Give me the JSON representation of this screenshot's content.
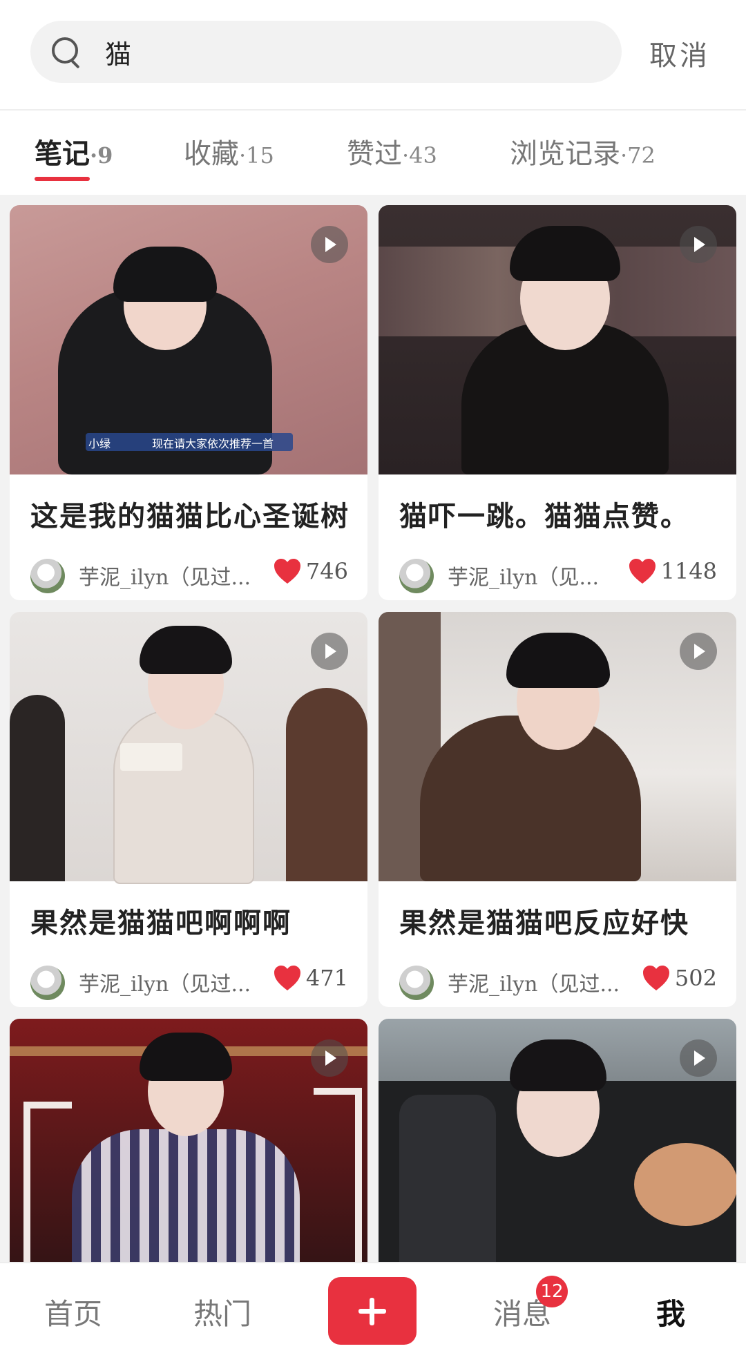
{
  "search": {
    "query": "猫",
    "cancel_label": "取消"
  },
  "tabs": [
    {
      "label": "笔记",
      "count": "·9"
    },
    {
      "label": "收藏",
      "count": "·15"
    },
    {
      "label": "赞过",
      "count": "·43"
    },
    {
      "label": "浏览记录",
      "count": "·72"
    }
  ],
  "notes": [
    {
      "title": "这是我的猫猫比心圣诞树",
      "author": "芋泥_ilyn（见过...",
      "likes": "746",
      "overlay": "现在请大家依次推荐一首",
      "overlay_tag": "小绿"
    },
    {
      "title": "猫吓一跳。猫猫点赞。",
      "author": "芋泥_ilyn（见...",
      "likes": "1148"
    },
    {
      "title": "果然是猫猫吧啊啊啊",
      "author": "芋泥_ilyn（见过...",
      "likes": "471"
    },
    {
      "title": "果然是猫猫吧反应好快",
      "author": "芋泥_ilyn（见过...",
      "likes": "502"
    },
    {
      "title": "",
      "author": "",
      "likes": ""
    },
    {
      "title": "",
      "author": "",
      "likes": ""
    }
  ],
  "nav": {
    "home": "首页",
    "hot": "热门",
    "messages": "消息",
    "messages_badge": "12",
    "me": "我"
  },
  "colors": {
    "accent": "#e8313f",
    "background": "#f2f2f2"
  }
}
